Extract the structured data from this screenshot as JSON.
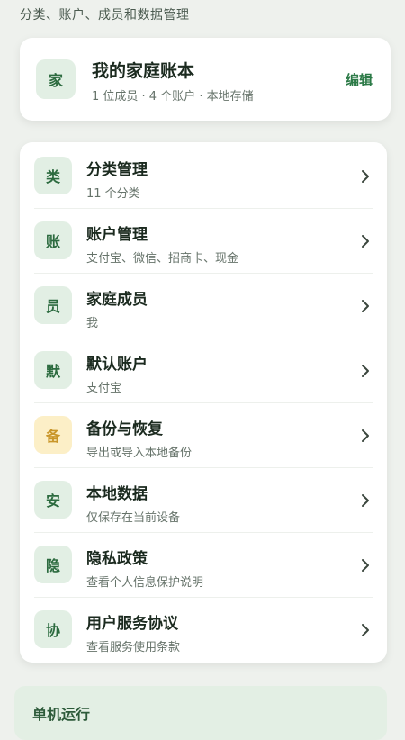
{
  "header": {
    "subtitle": "分类、账户、成员和数据管理"
  },
  "family": {
    "badge": "家",
    "title": "我的家庭账本",
    "summary": "1 位成员 · 4 个账户 · 本地存储",
    "edit_label": "编辑"
  },
  "menu": {
    "items": [
      {
        "badge": "类",
        "title": "分类管理",
        "subtitle": "11 个分类",
        "icon": "chevron-right-icon"
      },
      {
        "badge": "账",
        "title": "账户管理",
        "subtitle": "支付宝、微信、招商卡、现金",
        "icon": "chevron-right-icon"
      },
      {
        "badge": "员",
        "title": "家庭成员",
        "subtitle": "我",
        "icon": "chevron-right-icon"
      },
      {
        "badge": "默",
        "title": "默认账户",
        "subtitle": "支付宝",
        "icon": "chevron-right-icon"
      },
      {
        "badge": "备",
        "title": "备份与恢复",
        "subtitle": "导出或导入本地备份",
        "icon": "chevron-right-icon"
      },
      {
        "badge": "安",
        "title": "本地数据",
        "subtitle": "仅保存在当前设备",
        "icon": "chevron-right-icon"
      },
      {
        "badge": "隐",
        "title": "隐私政策",
        "subtitle": "查看个人信息保护说明",
        "icon": "chevron-right-icon"
      },
      {
        "badge": "协",
        "title": "用户服务协议",
        "subtitle": "查看服务使用条款",
        "icon": "chevron-right-icon"
      }
    ]
  },
  "footer": {
    "title": "单机运行"
  },
  "colors": {
    "accent": "#2c7a47",
    "badge_bg": "#e2efe4",
    "badge_warning_bg": "#fcefc7",
    "badge_warning_fg": "#c9962a",
    "page_bg": "#eef1ed"
  }
}
